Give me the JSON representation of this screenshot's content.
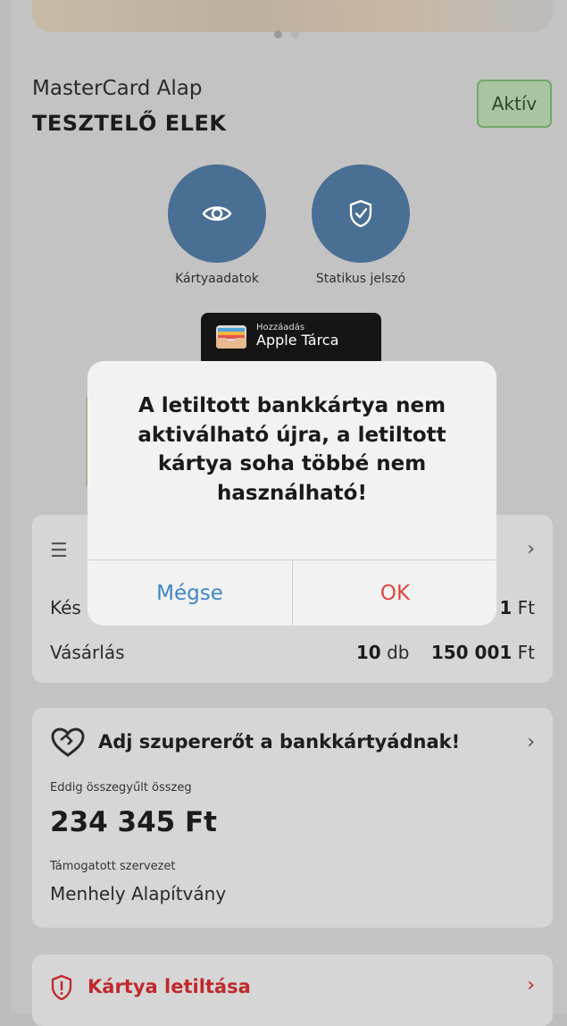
{
  "card": {
    "product": "MasterCard Alap",
    "holder": "TESZTELŐ ELEK",
    "status": "Aktív"
  },
  "actions": [
    {
      "label": "Kártyaadatok",
      "icon": "eye-icon"
    },
    {
      "label": "Statikus jelszó",
      "icon": "shield-check-icon"
    }
  ],
  "wallet": {
    "line1": "Hozzáadás",
    "line2": "Apple Tárca"
  },
  "limits": {
    "rows": [
      {
        "label": "Kés",
        "amount_tail": "1",
        "currency": "Ft"
      },
      {
        "label": "Vásárlás",
        "count": "10",
        "count_unit": "db",
        "amount": "150 001",
        "currency": "Ft"
      }
    ]
  },
  "superpower": {
    "title": "Adj szupererőt a bankkártyádnak!",
    "collected_label": "Eddig összegyűlt összeg",
    "collected_amount": "234 345 Ft",
    "org_label": "Támogatott szervezet",
    "org_name": "Menhely Alapítvány"
  },
  "block": {
    "label": "Kártya letiltása"
  },
  "dialog": {
    "message": "A letiltott bankkártya nem aktiválható újra, a letiltott kártya soha többé nem használható!",
    "cancel": "Mégse",
    "ok": "OK"
  },
  "colors": {
    "action_circle": "#4a6f94",
    "badge_border": "#72a86a",
    "danger": "#c0292b",
    "dialog_cancel": "#3d86c9",
    "dialog_ok": "#e04444"
  }
}
